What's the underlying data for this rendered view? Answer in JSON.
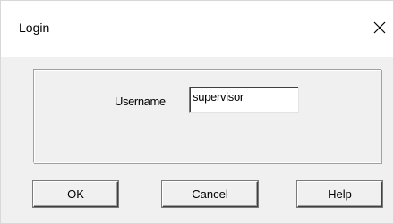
{
  "window": {
    "title": "Login",
    "close_icon": "close-icon"
  },
  "form": {
    "username_label": "Username",
    "username_value": "supervisor"
  },
  "buttons": {
    "ok_label": "OK",
    "cancel_label": "Cancel",
    "help_label": "Help"
  }
}
